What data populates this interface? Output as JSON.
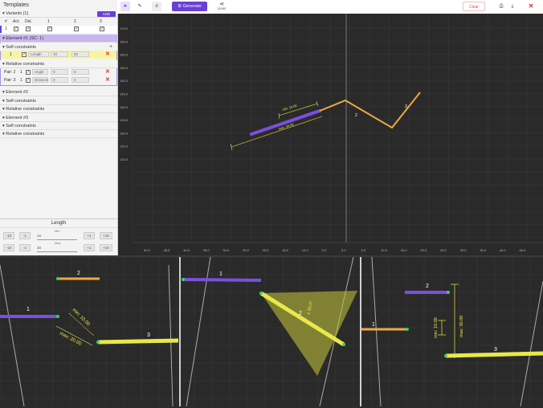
{
  "templates": {
    "title": "Templates",
    "variants_label": "Variants (1)",
    "add_label": "ADD",
    "columns": [
      "#",
      "Act.",
      "Del.",
      "1",
      "2",
      "3"
    ],
    "row_index": "1"
  },
  "element1": {
    "header": "Element #1 (SC: 1)",
    "self_constraints": "Self constraints",
    "length_row": {
      "index": "1",
      "label": "Length",
      "min": "10",
      "max": "30"
    },
    "relative_constraints": "Relative constraints",
    "pairs": [
      {
        "label": "Pair: 2",
        "index": "1",
        "type": "Angle",
        "min": "0",
        "max": "0"
      },
      {
        "label": "Pair: 3",
        "index": "1",
        "type": "Distance",
        "min": "0",
        "max": "0"
      }
    ]
  },
  "element2": {
    "header": "Element #2",
    "self_constraints": "Self constraints",
    "relative_constraints": "Relative constraints"
  },
  "element3": {
    "header": "Element #3",
    "self_constraints": "Self constraints",
    "relative_constraints": "Relative constraints"
  },
  "length_panel": {
    "title": "Length",
    "min_label": "Min",
    "max_label": "Max",
    "min_value": "10",
    "max_value": "30",
    "buttons": [
      "-10",
      "-1",
      "+1",
      "+10"
    ]
  },
  "toolbar": {
    "generate_label": "Generate",
    "lines_label": "Lines",
    "clear_label": "Clear"
  },
  "canvas": {
    "y_ticks": [
      "170.0",
      "165.0",
      "160.0",
      "155.0",
      "150.0",
      "145.0",
      "140.0",
      "135.0",
      "130.0",
      "125.0",
      "120.0"
    ],
    "x_ticks": [
      "50.0",
      "45.0",
      "40.0",
      "35.0",
      "30.0",
      "25.0",
      "20.0",
      "15.0",
      "10.0",
      "5.0",
      "0.0",
      "5.0",
      "10.0",
      "15.0",
      "20.0",
      "25.0",
      "30.0",
      "35.0",
      "40.0",
      "45.0"
    ],
    "dim_min": "min: 10.00",
    "dim_max": "max: 30.00",
    "label_2": "2",
    "label_3": "3"
  },
  "previews": {
    "p1": {
      "l1": "1",
      "l2": "2",
      "l3": "3",
      "min": "min: 10.00",
      "max": "max: 20.00"
    },
    "p2": {
      "l1": "1",
      "l2": "2",
      "angle": "± 30.0°"
    },
    "p3": {
      "l1": "1",
      "l2": "2",
      "l3": "3",
      "min": "min: 10.00",
      "max": "max: 30.00"
    }
  },
  "colors": {
    "accent": "#6a3fd6",
    "purple_line": "#7b4fe0",
    "yellow_line": "#e8e84a",
    "orange_line": "#f0a840",
    "clear_red": "#e05050"
  }
}
